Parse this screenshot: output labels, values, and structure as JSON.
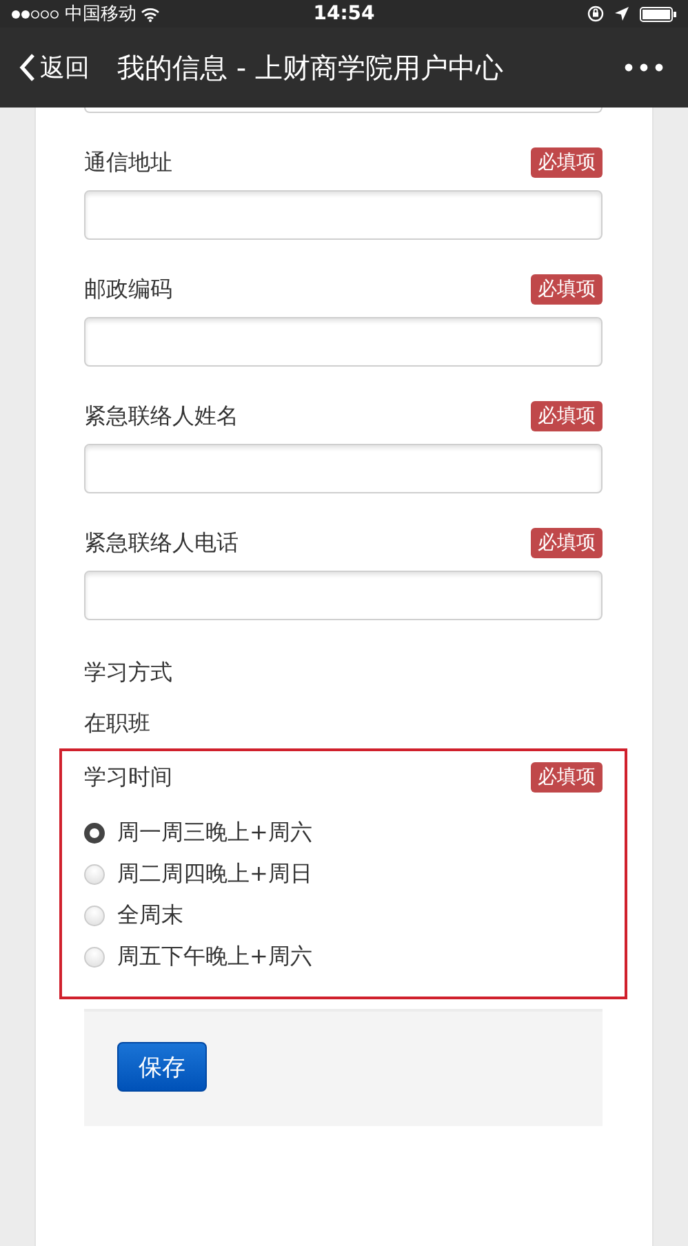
{
  "status_bar": {
    "carrier": "中国移动",
    "time": "14:54"
  },
  "nav_bar": {
    "back": "返回",
    "title": "我的信息 - 上财商学院用户中心"
  },
  "fields": [
    {
      "label": "通信地址",
      "badge": "必填项"
    },
    {
      "label": "邮政编码",
      "badge": "必填项"
    },
    {
      "label": "紧急联络人姓名",
      "badge": "必填项"
    },
    {
      "label": "紧急联络人电话",
      "badge": "必填项"
    }
  ],
  "study_mode": {
    "label": "学习方式",
    "value": "在职班"
  },
  "study_time": {
    "label": "学习时间",
    "badge": "必填项",
    "highlighted": true,
    "options": [
      {
        "label": "周一周三晚上+周六",
        "selected": true
      },
      {
        "label": "周二周四晚上+周日",
        "selected": false
      },
      {
        "label": "全周末",
        "selected": false
      },
      {
        "label": "周五下午晚上+周六",
        "selected": false
      }
    ]
  },
  "save_button": "保存"
}
